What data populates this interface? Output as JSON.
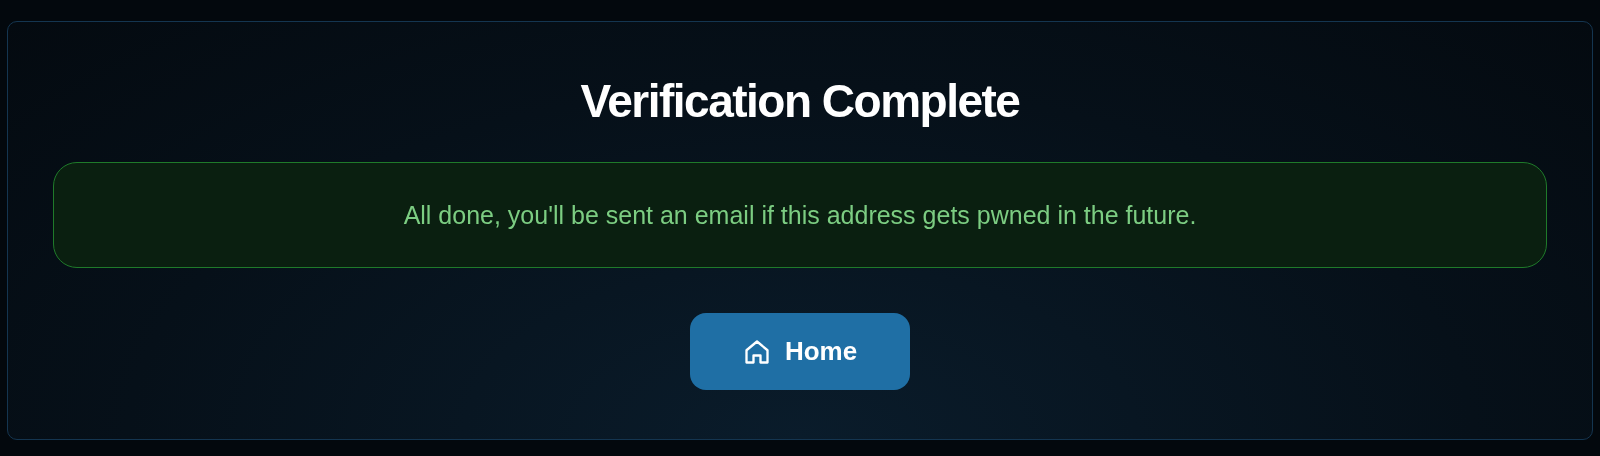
{
  "title": "Verification Complete",
  "alert": {
    "text": "All done, you'll be sent an email if this address gets pwned in the future."
  },
  "button": {
    "label": "Home"
  }
}
